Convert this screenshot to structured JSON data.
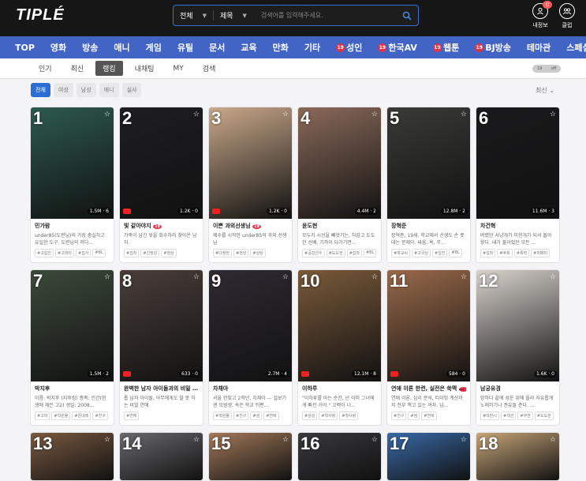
{
  "header": {
    "logo": "TIPLÉ",
    "search": {
      "scope": "전체",
      "field": "제목",
      "placeholder": "검색어를 입력해주세요."
    },
    "my_info": {
      "label": "내정보",
      "badge": "0"
    },
    "club": {
      "label": "클럽"
    }
  },
  "nav": [
    {
      "label": "TOP"
    },
    {
      "label": "영화"
    },
    {
      "label": "방송"
    },
    {
      "label": "애니"
    },
    {
      "label": "게임"
    },
    {
      "label": "유틸"
    },
    {
      "label": "문서"
    },
    {
      "label": "교육"
    },
    {
      "label": "만화"
    },
    {
      "label": "기타"
    },
    {
      "label": "성인",
      "adult": "19"
    },
    {
      "label": "한국AV",
      "adult": "19"
    },
    {
      "label": "웹툰",
      "adult": "19"
    },
    {
      "label": "BJ방송",
      "adult": "19"
    },
    {
      "label": "테마관"
    },
    {
      "label": "스페셜"
    }
  ],
  "subtabs": [
    {
      "label": "인기"
    },
    {
      "label": "최신"
    },
    {
      "label": "랭킹",
      "active": true
    },
    {
      "label": "내채팅"
    },
    {
      "label": "MY"
    },
    {
      "label": "검색"
    }
  ],
  "filters": [
    {
      "label": "전체",
      "active": true
    },
    {
      "label": "여성"
    },
    {
      "label": "남성"
    },
    {
      "label": "애니"
    },
    {
      "label": "실사"
    }
  ],
  "sort": "최신",
  "colors": {
    "nav_bg": "#4264c5",
    "accent": "#2b6fd6",
    "top_bg": "#161616"
  },
  "cards": [
    {
      "rank": "1",
      "name": "민가람",
      "desc": "under85(도련님)의 가장 충실하고 유일한 도구. 도련님의 저다...",
      "stats": "1.5M · 6",
      "tags": [
        "#고집진",
        "#고데타",
        "#집사",
        "#BL"
      ],
      "bg": "#2d5a4e"
    },
    {
      "rank": "2",
      "name": "빛 같아야지",
      "desc": "가족이 남긴 빚을 회수하러 찾아온 남자.",
      "stats": "1.2K · 0",
      "tags": [
        "#집착",
        "#긴장감",
        "#현상"
      ],
      "bg": "#1e1e22",
      "adult": true,
      "yt": true
    },
    {
      "rank": "3",
      "name": "이쁜 과외선생님",
      "desc": "제수를 시작한 under85의 과외 선생님",
      "stats": "1.2K · 0",
      "tags": [
        "#다정한",
        "#현상",
        "#상담"
      ],
      "bg": "#c9a98a",
      "adult": true,
      "yt": true
    },
    {
      "rank": "4",
      "name": "윤도현",
      "desc": "모두가 시선을 빼앗기는, 차갑고 도도한 선배. 기까이 다가기면...",
      "stats": "4.4M · 2",
      "tags": [
        "#공감선수",
        "#도도한",
        "#집착",
        "#BL"
      ],
      "bg": "#8a6a5a"
    },
    {
      "rank": "5",
      "name": "장혁준",
      "desc": "장혁준, 19세. 학교에서 선생도 손 못 대는 문제아. 싸움, 욕, 무...",
      "stats": "12.8M · 2",
      "tags": [
        "#학교씨",
        "#고국님",
        "#일진",
        "#BL"
      ],
      "bg": "#3a3a38"
    },
    {
      "rank": "6",
      "name": "차건혁",
      "desc": "버렸던 사냥개가 미친개가 되서 돌아왔다. 내가 불이었던 모든 ...",
      "stats": "11.6M · 3",
      "tags": [
        "#집착",
        "#후회",
        "#폭력",
        "#피폐미"
      ],
      "bg": "#1a1a1c"
    },
    {
      "rank": "7",
      "name": "박지후",
      "desc": "이름: 박지후 (지후킴) 종족: 인간(현생에 제든 고2) 생일: 2008...",
      "stats": "1.5M · 2",
      "tags": [
        "#고마",
        "#학원물",
        "#존데레",
        "#친구"
      ],
      "bg": "#3c4a3a"
    },
    {
      "rank": "8",
      "name": "완벽한 남자 아이돌과의 비밀 연애",
      "desc": "톱 남자 아이돌, 아무에게도 말 못 하는 비밀 연애",
      "stats": "633 · 0",
      "tags": [
        "#연애"
      ],
      "bg": "#4a3e3a",
      "adult": true,
      "yt": true
    },
    {
      "rank": "9",
      "name": "차채아",
      "desc": "서울 한빛고 2학년, 치채아 — 걸보기엔 모범생, 속은 학교 뒤편...",
      "stats": "2.7M · 4",
      "tags": [
        "#학원물",
        "#친구",
        "#섬",
        "#연애"
      ],
      "bg": "#2e2a33"
    },
    {
      "rank": "10",
      "name": "이하루",
      "desc": "\"이하루를 아는 순간, 넌 이미 그녀에게 빠진 거야.\" 고백이 너...",
      "stats": "12.1M · 8",
      "tags": [
        "#감성",
        "#학사랑",
        "#첫사랑"
      ],
      "bg": "#7a5a3a",
      "yt": true
    },
    {
      "rank": "11",
      "name": "연애 이론 한켠, 실전은 쑥맥",
      "desc": "연애 이론, 심리 분석, 티이밍 계산까지 전부 책고 있는 여자. 남...",
      "stats": "584 · 0",
      "tags": [
        "#친구",
        "#썸",
        "#연애"
      ],
      "bg": "#9a6a4a",
      "adult": true,
      "yt": true
    },
    {
      "rank": "12",
      "name": "남궁유경",
      "desc": "망하다 끝에 성운 위에 올라 자유롭게 노래하기나 권유돌 춘다. ...",
      "stats": "1.6K · 0",
      "tags": [
        "#마찬시",
        "#섹션",
        "#부연",
        "#도도한"
      ],
      "bg": "#d8d2cc"
    },
    {
      "rank": "13",
      "bg": "#7a5a40"
    },
    {
      "rank": "14",
      "bg": "#6a6a6e"
    },
    {
      "rank": "15",
      "bg": "#a47a5a"
    },
    {
      "rank": "16",
      "bg": "#3a3a3e"
    },
    {
      "rank": "17",
      "bg": "#3a6aa8"
    },
    {
      "rank": "18",
      "bg": "#c8a67a"
    }
  ]
}
